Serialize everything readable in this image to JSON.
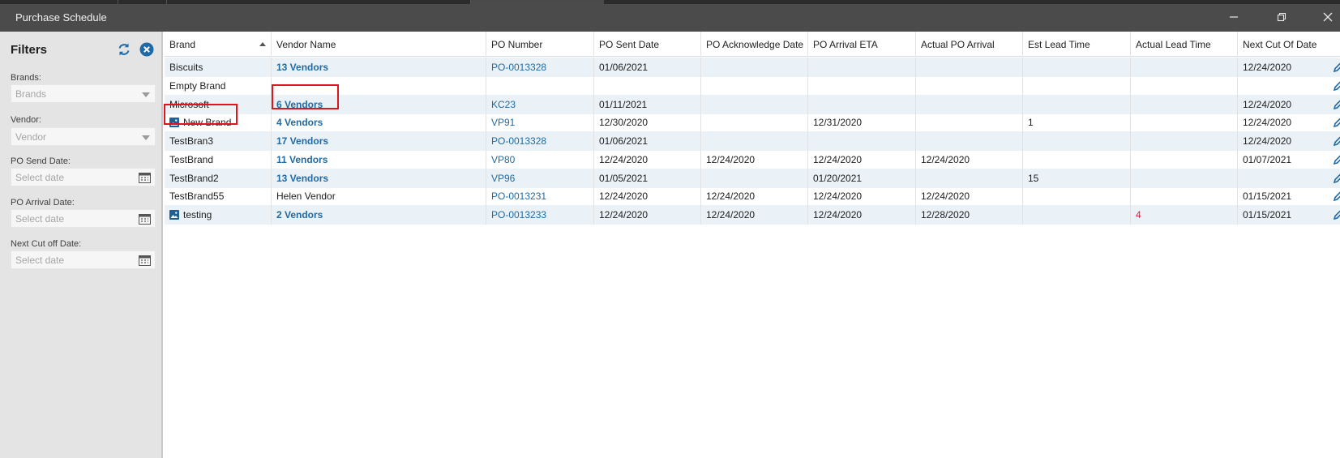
{
  "window": {
    "title": "Purchase Schedule"
  },
  "filters": {
    "title": "Filters",
    "brands": {
      "label": "Brands:",
      "placeholder": "Brands"
    },
    "vendor": {
      "label": "Vendor:",
      "placeholder": "Vendor"
    },
    "po_send_date": {
      "label": "PO Send Date:",
      "placeholder": "Select date"
    },
    "po_arrival_date": {
      "label": "PO Arrival Date:",
      "placeholder": "Select date"
    },
    "next_cutoff_date": {
      "label": "Next Cut off Date:",
      "placeholder": "Select date"
    }
  },
  "grid": {
    "columns": [
      "Brand",
      "Vendor Name",
      "PO Number",
      "PO Sent Date",
      "PO Acknowledge Date",
      "PO Arrival ETA",
      "Actual PO Arrival",
      "Est Lead Time",
      "Actual Lead Time",
      "Next Cut Of Date"
    ],
    "sorted_column": "Brand",
    "rows": [
      {
        "brand": "Biscuits",
        "brand_icon": false,
        "vendor": "13 Vendors",
        "vendor_link": true,
        "po": "PO-0013328",
        "sent": "01/06/2021",
        "ack": "",
        "eta": "",
        "actual": "",
        "est": "",
        "actual_lead": "",
        "next_cut": "12/24/2020"
      },
      {
        "brand": "Empty Brand",
        "brand_icon": false,
        "vendor": "",
        "vendor_link": false,
        "po": "",
        "sent": "",
        "ack": "",
        "eta": "",
        "actual": "",
        "est": "",
        "actual_lead": "",
        "next_cut": ""
      },
      {
        "brand": "Microsoft",
        "brand_icon": false,
        "vendor": "6 Vendors",
        "vendor_link": true,
        "po": "KC23",
        "sent": "01/11/2021",
        "ack": "",
        "eta": "",
        "actual": "",
        "est": "",
        "actual_lead": "",
        "next_cut": "12/24/2020"
      },
      {
        "brand": "New Brand",
        "brand_icon": true,
        "vendor": "4 Vendors",
        "vendor_link": true,
        "po": "VP91",
        "sent": "12/30/2020",
        "ack": "",
        "eta": "12/31/2020",
        "actual": "",
        "est": "1",
        "actual_lead": "",
        "next_cut": "12/24/2020"
      },
      {
        "brand": "TestBran3",
        "brand_icon": false,
        "vendor": "17 Vendors",
        "vendor_link": true,
        "po": "PO-0013328",
        "sent": "01/06/2021",
        "ack": "",
        "eta": "",
        "actual": "",
        "est": "",
        "actual_lead": "",
        "next_cut": "12/24/2020"
      },
      {
        "brand": "TestBrand",
        "brand_icon": false,
        "vendor": "11 Vendors",
        "vendor_link": true,
        "po": "VP80",
        "sent": "12/24/2020",
        "ack": "12/24/2020",
        "eta": "12/24/2020",
        "actual": "12/24/2020",
        "est": "",
        "actual_lead": "",
        "next_cut": "01/07/2021"
      },
      {
        "brand": "TestBrand2",
        "brand_icon": false,
        "vendor": "13 Vendors",
        "vendor_link": true,
        "po": "VP96",
        "sent": "01/05/2021",
        "ack": "",
        "eta": "01/20/2021",
        "actual": "",
        "est": "15",
        "actual_lead": "",
        "next_cut": ""
      },
      {
        "brand": "TestBrand55",
        "brand_icon": false,
        "vendor": "Helen Vendor",
        "vendor_link": false,
        "po": "PO-0013231",
        "sent": "12/24/2020",
        "ack": "12/24/2020",
        "eta": "12/24/2020",
        "actual": "12/24/2020",
        "est": "",
        "actual_lead": "",
        "next_cut": "01/15/2021"
      },
      {
        "brand": "testing",
        "brand_icon": true,
        "vendor": "2 Vendors",
        "vendor_link": true,
        "po": "PO-0013233",
        "sent": "12/24/2020",
        "ack": "12/24/2020",
        "eta": "12/24/2020",
        "actual": "12/28/2020",
        "est": "",
        "actual_lead": "4",
        "next_cut": "01/15/2021"
      }
    ]
  },
  "colors": {
    "link": "#1f6aa5",
    "alert": "#e02020",
    "highlight": "#e0141e",
    "alt_row": "#eaf2f7",
    "titlebar": "#4b4b4b"
  }
}
